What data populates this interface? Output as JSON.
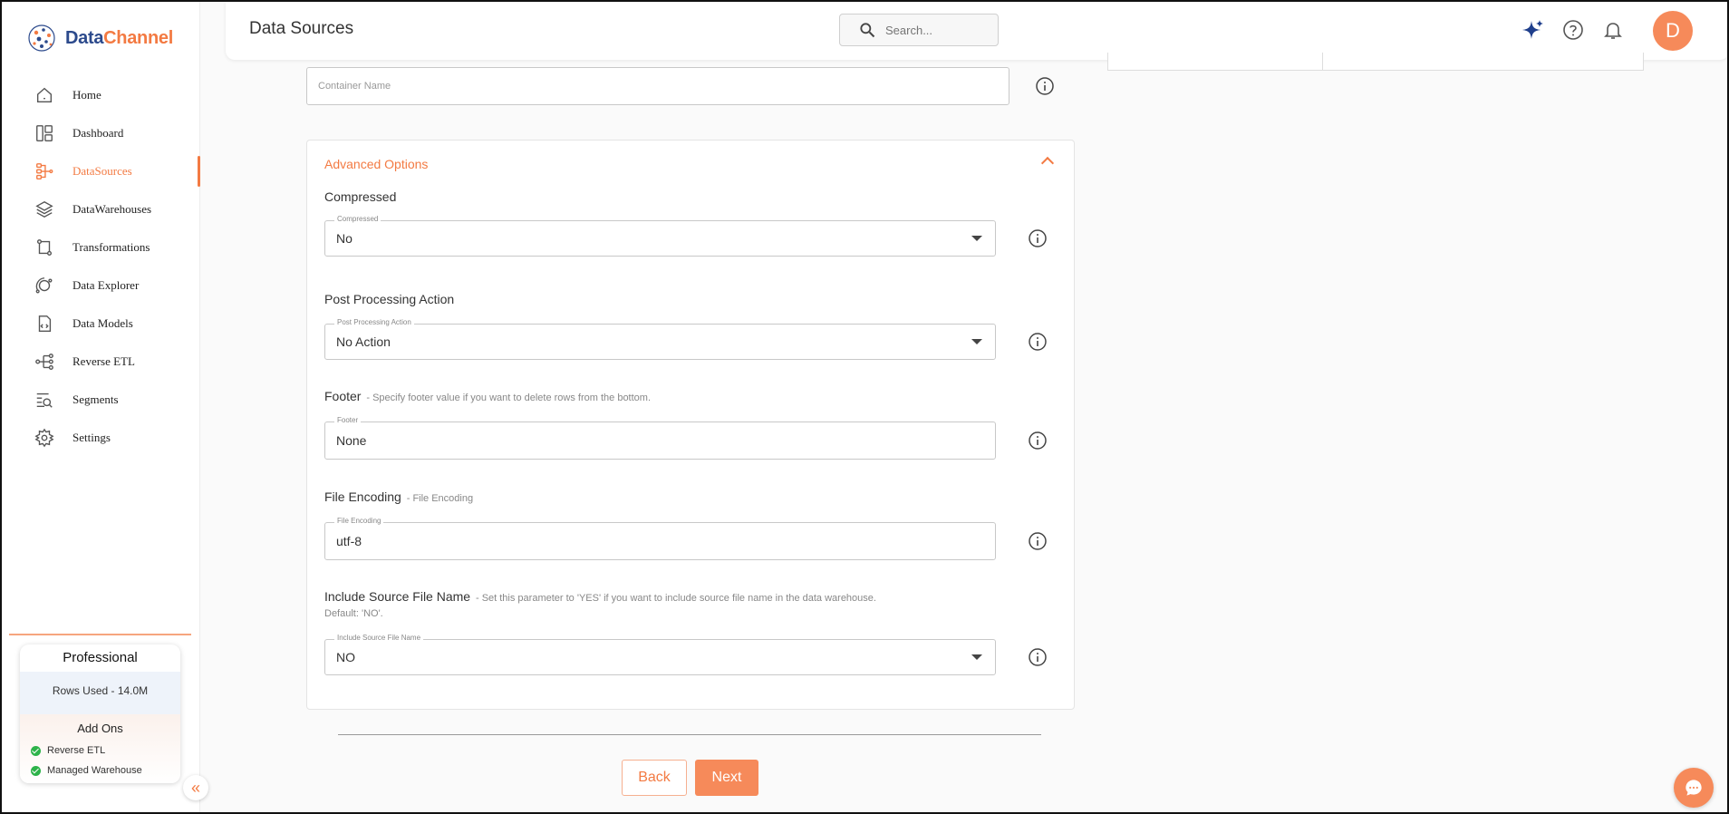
{
  "brand": {
    "logo_part1": "Data",
    "logo_part2": "Channel",
    "accent": "#f37a42"
  },
  "header": {
    "title": "Data Sources",
    "search_placeholder": "Search...",
    "avatar_letter": "D"
  },
  "sidebar": {
    "items": [
      {
        "label": "Home",
        "icon": "home-icon"
      },
      {
        "label": "Dashboard",
        "icon": "dashboard-icon"
      },
      {
        "label": "DataSources",
        "icon": "datasources-icon",
        "active": true
      },
      {
        "label": "DataWarehouses",
        "icon": "layers-icon"
      },
      {
        "label": "Transformations",
        "icon": "transform-icon"
      },
      {
        "label": "Data Explorer",
        "icon": "explorer-icon"
      },
      {
        "label": "Data Models",
        "icon": "data-models-icon"
      },
      {
        "label": "Reverse ETL",
        "icon": "reverse-etl-icon"
      },
      {
        "label": "Segments",
        "icon": "segments-icon"
      },
      {
        "label": "Settings",
        "icon": "gear-icon"
      }
    ],
    "plan": {
      "name": "Professional",
      "rows_used": "Rows Used - 14.0M",
      "addons_title": "Add Ons",
      "addons": [
        "Reverse ETL",
        "Managed Warehouse"
      ]
    },
    "collapse_glyph": "«"
  },
  "form": {
    "container_name": {
      "placeholder": "Container Name",
      "value": ""
    },
    "advanced": {
      "title": "Advanced Options",
      "compressed": {
        "label": "Compressed",
        "float_label": "Compressed",
        "value": "No"
      },
      "post_processing": {
        "label": "Post Processing Action",
        "float_label": "Post Processing Action",
        "value": "No Action"
      },
      "footer": {
        "label": "Footer",
        "hint": "- Specify footer value if you want to delete rows from the bottom.",
        "float_label": "Footer",
        "value": "None"
      },
      "file_encoding": {
        "label": "File Encoding",
        "hint": "- File Encoding",
        "float_label": "File Encoding",
        "value": "utf-8"
      },
      "include_source": {
        "label": "Include Source File Name",
        "hint": "- Set this parameter to 'YES' if you want to include source file name in the data warehouse.",
        "sub": "Default: 'NO'.",
        "float_label": "Include Source File Name",
        "value": "NO"
      }
    }
  },
  "actions": {
    "back": "Back",
    "next": "Next"
  }
}
